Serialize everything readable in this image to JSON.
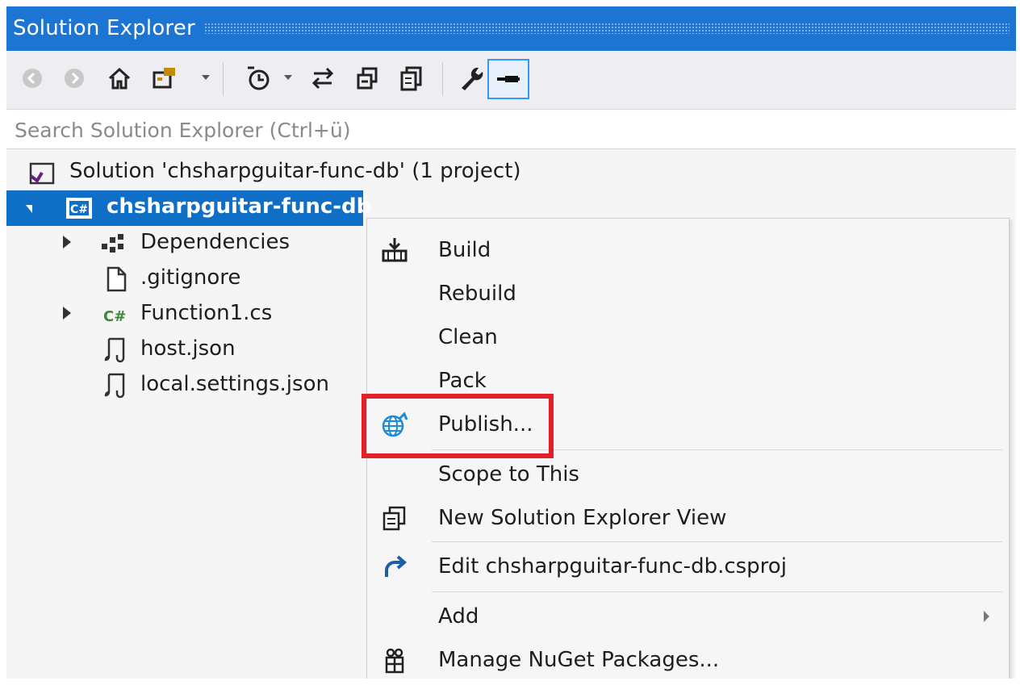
{
  "window": {
    "title": "Solution Explorer"
  },
  "toolbar": {
    "icons": [
      "back-icon",
      "forward-icon",
      "home-icon",
      "switch-views-icon",
      "pending-changes-filter-icon",
      "sync-with-document-icon",
      "collapse-all-icon",
      "show-all-files-icon",
      "properties-icon",
      "preview-selected-items-icon"
    ],
    "accent": "#3399ff"
  },
  "search": {
    "placeholder": "Search Solution Explorer (Ctrl+ü)"
  },
  "tree": {
    "solution": "Solution 'chsharpguitar-func-db' (1 project)",
    "project": "chsharpguitar-func-db",
    "items": [
      {
        "label": "Dependencies",
        "icon": "dependencies-icon",
        "expandable": true
      },
      {
        "label": ".gitignore",
        "icon": "file-icon",
        "expandable": false
      },
      {
        "label": "Function1.cs",
        "icon": "csharp-file-icon",
        "expandable": true
      },
      {
        "label": "host.json",
        "icon": "json-file-icon",
        "expandable": false
      },
      {
        "label": "local.settings.json",
        "icon": "json-file-icon",
        "expandable": false
      }
    ]
  },
  "context_menu": {
    "items": [
      {
        "label": "Build",
        "icon": "build-icon"
      },
      {
        "label": "Rebuild",
        "icon": ""
      },
      {
        "label": "Clean",
        "icon": ""
      },
      {
        "label": "Pack",
        "icon": ""
      },
      {
        "label": "Publish...",
        "icon": "publish-globe-icon",
        "highlighted": true
      },
      {
        "label": "Scope to This",
        "icon": ""
      },
      {
        "label": "New Solution Explorer View",
        "icon": "new-view-icon"
      },
      {
        "label": "Edit chsharpguitar-func-db.csproj",
        "icon": "edit-redo-arrow-icon"
      },
      {
        "label": "Add",
        "icon": "",
        "submenu": true
      },
      {
        "label": "Manage NuGet Packages...",
        "icon": "nuget-package-icon"
      }
    ]
  },
  "colors": {
    "title_bar": "#1c75d2",
    "selection": "#0f6fc6",
    "highlight_box": "#e3202a"
  }
}
